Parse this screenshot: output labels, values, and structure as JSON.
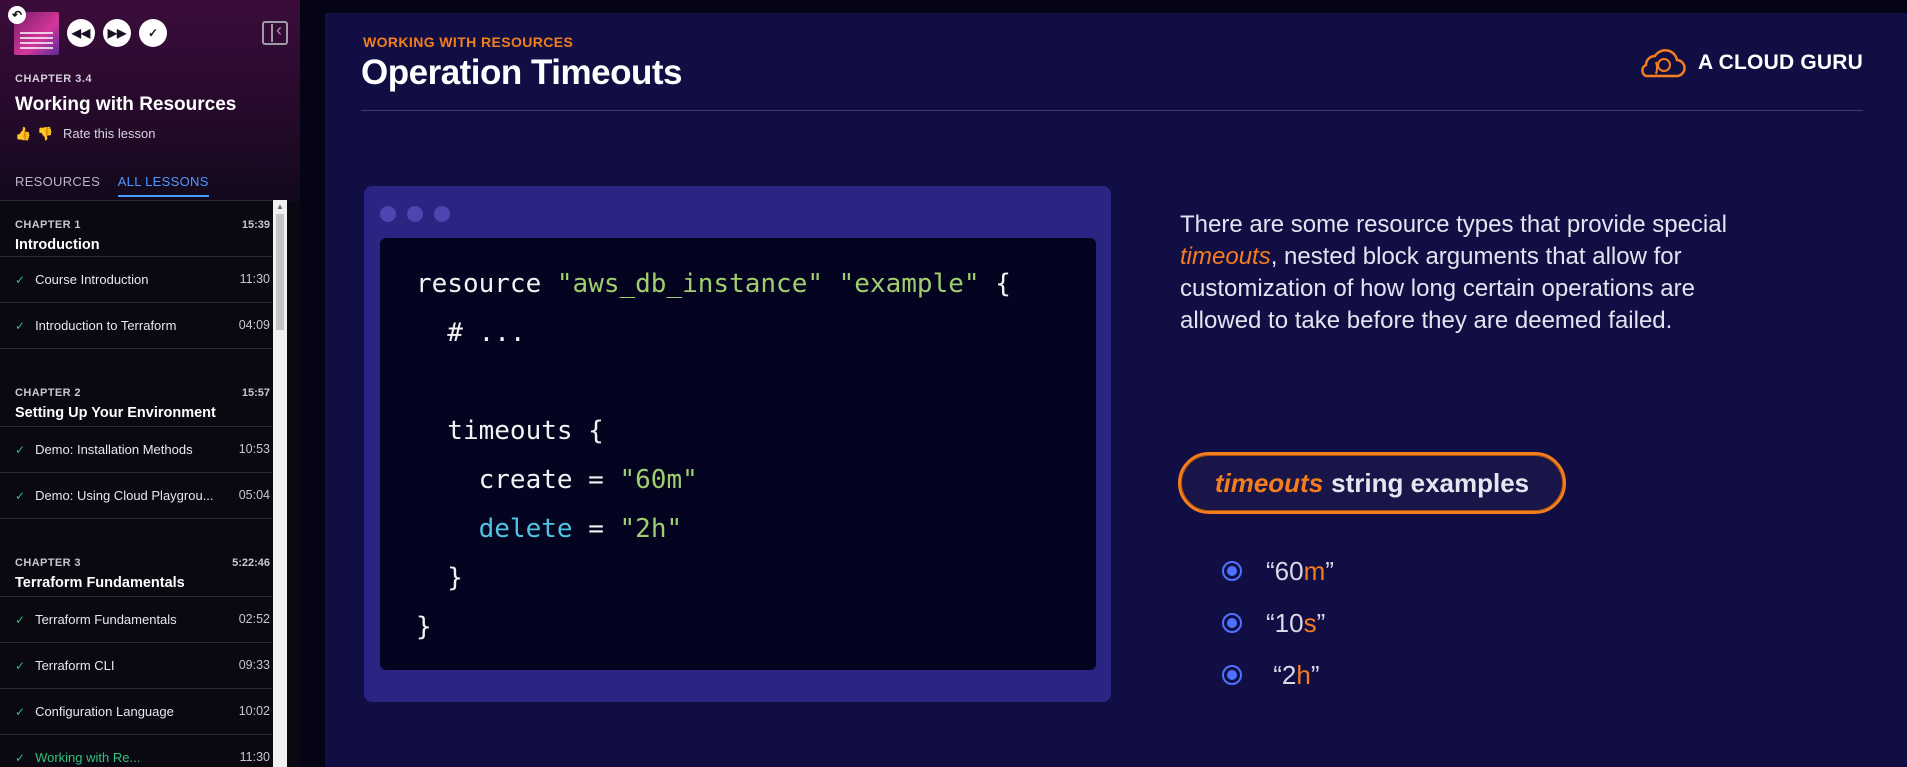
{
  "sidebar": {
    "chapter_tag": "CHAPTER 3.4",
    "lesson_title": "Working with Resources",
    "rate_label": "Rate this lesson",
    "tabs": [
      {
        "label": "RESOURCES",
        "active": false
      },
      {
        "label": "ALL LESSONS",
        "active": true
      }
    ],
    "chapters": [
      {
        "label": "CHAPTER 1",
        "time": "15:39",
        "name": "Introduction",
        "lessons": [
          {
            "title": "Course Introduction",
            "time": "11:30"
          },
          {
            "title": "Introduction to Terraform",
            "time": "04:09"
          }
        ]
      },
      {
        "label": "CHAPTER 2",
        "time": "15:57",
        "name": "Setting Up Your Environment",
        "lessons": [
          {
            "title": "Demo: Installation Methods",
            "time": "10:53"
          },
          {
            "title": "Demo: Using Cloud Playgrou...",
            "time": "05:04"
          }
        ]
      },
      {
        "label": "CHAPTER 3",
        "time": "5:22:46",
        "name": "Terraform Fundamentals",
        "lessons": [
          {
            "title": "Terraform Fundamentals",
            "time": "02:52"
          },
          {
            "title": "Terraform CLI",
            "time": "09:33"
          },
          {
            "title": "Configuration Language",
            "time": "10:02"
          },
          {
            "title": "Working with Re...",
            "time": "11:30"
          }
        ]
      }
    ]
  },
  "slide": {
    "eyebrow": "WORKING WITH RESOURCES",
    "title": "Operation Timeouts",
    "brand": "A CLOUD GURU",
    "code": {
      "l1_a": "resource ",
      "l1_s1": "\"aws_db_instance\"",
      "l1_sp": " ",
      "l1_s2": "\"example\"",
      "l1_b": " {",
      "l2": "  # ...",
      "l3": "",
      "l4": "  timeouts {",
      "l5_a": "    create = ",
      "l5_s": "\"60m\"",
      "l6_pad": "    ",
      "l6_kw": "delete",
      "l6_eq": " = ",
      "l6_s": "\"2h\"",
      "l7": "  }",
      "l8": "}"
    },
    "desc_before": "There are some resource types that provide special ",
    "desc_highlight": "timeouts",
    "desc_after": ", nested block arguments that allow for customization of how long certain operations are allowed to take before they are deemed failed.",
    "pill_highlight": "timeouts",
    "pill_rest": "string examples",
    "examples": [
      {
        "pre": "“60",
        "unit": "m",
        "post": "”"
      },
      {
        "pre": "“10",
        "unit": "s",
        "post": "”"
      },
      {
        "pre": " “2",
        "unit": "h",
        "post": "”"
      }
    ]
  },
  "colors": {
    "accent_orange": "#f47d1d",
    "link_blue": "#4a9bff",
    "check_green": "#2ec27e",
    "slide_bg": "#110e44"
  }
}
